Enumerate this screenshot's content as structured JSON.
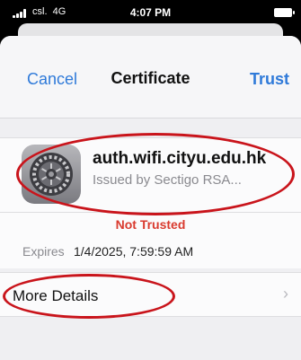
{
  "status_bar": {
    "carrier": "csl.",
    "network": "4G",
    "time": "4:07 PM"
  },
  "nav": {
    "cancel_label": "Cancel",
    "title": "Certificate",
    "trust_label": "Trust"
  },
  "certificate": {
    "name": "auth.wifi.cityu.edu.hk",
    "issuer": "Issued by Sectigo RSA...",
    "icon": "settings-gear-icon"
  },
  "trust_status": "Not Trusted",
  "expires": {
    "label": "Expires",
    "value": "1/4/2025, 7:59:59 AM"
  },
  "details": {
    "label": "More Details"
  },
  "colors": {
    "accent": "#2f7ad9",
    "warning": "#d93a2e",
    "annotation": "#c9141b"
  }
}
